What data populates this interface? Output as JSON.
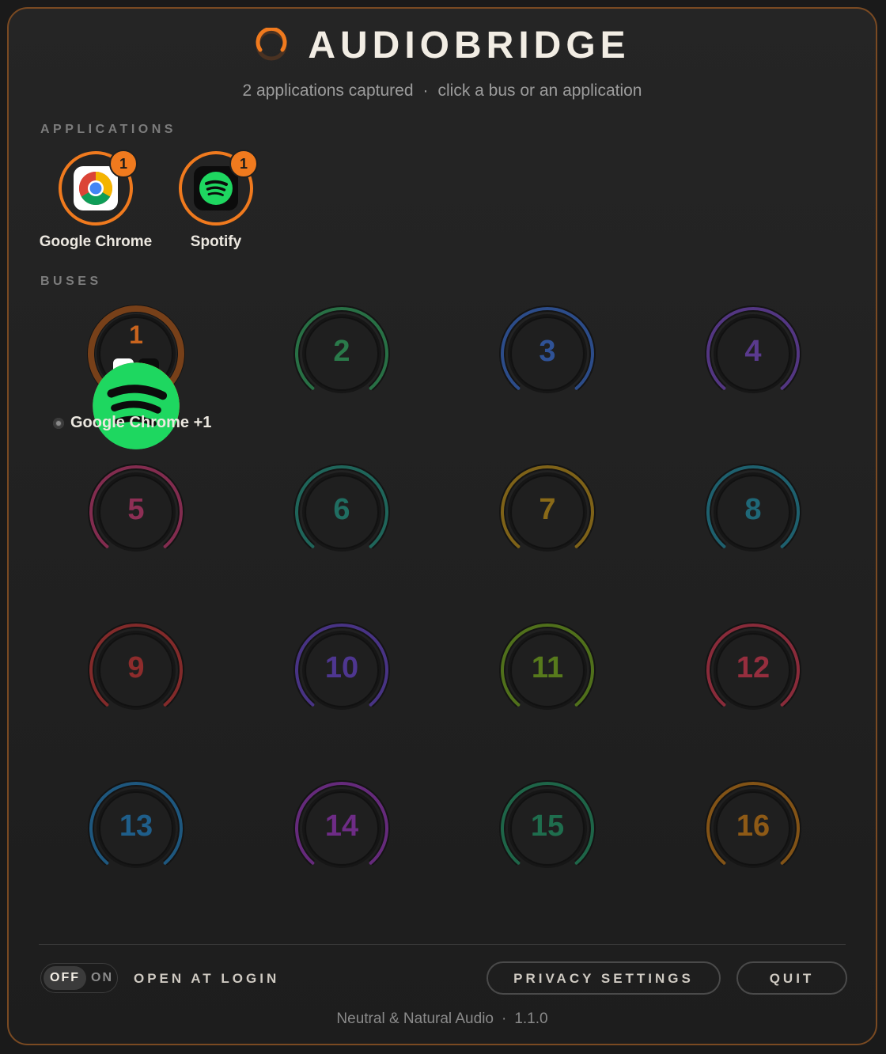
{
  "header": {
    "title": "AUDIOBRIDGE",
    "subtitle_count": "2 applications captured",
    "subtitle_separator": "·",
    "subtitle_hint": "click a bus or an application",
    "accent_color": "#f07a1e"
  },
  "applications": {
    "label": "APPLICATIONS",
    "items": [
      {
        "name": "Google Chrome",
        "badge": "1",
        "icon": "chrome-icon"
      },
      {
        "name": "Spotify",
        "badge": "1",
        "icon": "spotify-icon"
      }
    ]
  },
  "buses": {
    "label": "BUSES",
    "items": [
      {
        "number": "1",
        "color": "#c8641e",
        "active": true,
        "apps": [
          "chrome-icon",
          "spotify-icon"
        ]
      },
      {
        "number": "2",
        "color": "#2a7a4a"
      },
      {
        "number": "3",
        "color": "#2f5296"
      },
      {
        "number": "4",
        "color": "#5a3a8e"
      },
      {
        "number": "5",
        "color": "#8e2f55"
      },
      {
        "number": "6",
        "color": "#206e62"
      },
      {
        "number": "7",
        "color": "#8a6a18"
      },
      {
        "number": "8",
        "color": "#1f6878"
      },
      {
        "number": "9",
        "color": "#8e2c2c"
      },
      {
        "number": "10",
        "color": "#4e3690"
      },
      {
        "number": "11",
        "color": "#577a1c"
      },
      {
        "number": "12",
        "color": "#962e3e"
      },
      {
        "number": "13",
        "color": "#1f5e8a"
      },
      {
        "number": "14",
        "color": "#6e2c86"
      },
      {
        "number": "15",
        "color": "#1f6e4e"
      },
      {
        "number": "16",
        "color": "#8e5a16"
      }
    ],
    "active_caption": "Google Chrome +1"
  },
  "footer_bar": {
    "toggle_off": "OFF",
    "toggle_on": "ON",
    "open_at_login": "OPEN AT LOGIN",
    "privacy_settings": "PRIVACY SETTINGS",
    "quit": "QUIT"
  },
  "footer": {
    "brand": "Neutral & Natural Audio",
    "separator": "·",
    "version": "1.1.0"
  }
}
